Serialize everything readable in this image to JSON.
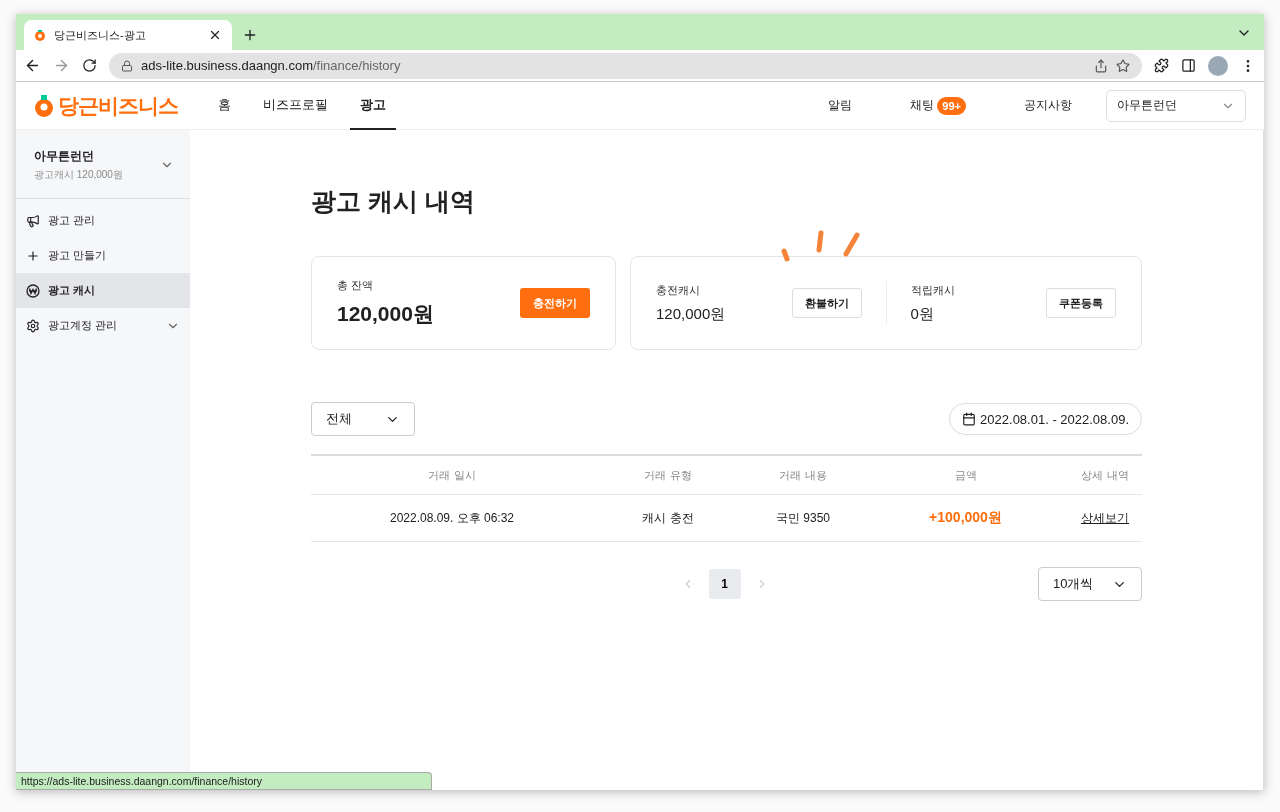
{
  "browser": {
    "tab_title": "당근비즈니스-광고",
    "url_host": "ads-lite.business.daangn.com",
    "url_path": "/finance/history",
    "status_url": "https://ads-lite.business.daangn.com/finance/history"
  },
  "header": {
    "logo": "당근비즈니스",
    "nav": [
      {
        "label": "홈",
        "selected": false
      },
      {
        "label": "비즈프로필",
        "selected": false
      },
      {
        "label": "광고",
        "selected": true
      }
    ],
    "links": [
      {
        "label": "알림"
      },
      {
        "label": "채팅",
        "badge": "99+"
      },
      {
        "label": "공지사항"
      }
    ],
    "account_select": "아무튼런던"
  },
  "sidebar": {
    "account_name": "아무튼런던",
    "account_cash": "광고캐시 120,000원",
    "items": [
      {
        "label": "광고 관리",
        "kind": "megaphone",
        "selected": false,
        "expandable": false
      },
      {
        "label": "광고 만들기",
        "kind": "plus",
        "selected": false,
        "expandable": false
      },
      {
        "label": "광고 캐시",
        "kind": "won",
        "selected": true,
        "expandable": false
      },
      {
        "label": "광고계정 관리",
        "kind": "gear",
        "selected": false,
        "expandable": true
      }
    ]
  },
  "page": {
    "title": "광고 캐시 내역",
    "balance": {
      "label": "총 잔액",
      "amount": "120,000원",
      "button": "충전하기"
    },
    "cash": [
      {
        "label": "충전캐시",
        "amount": "120,000원",
        "button": "환불하기"
      },
      {
        "label": "적립캐시",
        "amount": "0원",
        "button": "쿠폰등록"
      }
    ],
    "filter": "전체",
    "date_range": "2022.08.01. - 2022.08.09.",
    "table": {
      "columns": [
        "거래 일시",
        "거래 유형",
        "거래 내용",
        "금액",
        "상세 내역"
      ],
      "rows": [
        {
          "date": "2022.08.09. 오후 06:32",
          "type": "캐시 충전",
          "detail": "국민 9350",
          "amount": "+100,000원",
          "link": "상세보기"
        }
      ]
    },
    "pages": [
      {
        "label": "1",
        "selected": true
      }
    ],
    "page_size": "10개씩"
  }
}
